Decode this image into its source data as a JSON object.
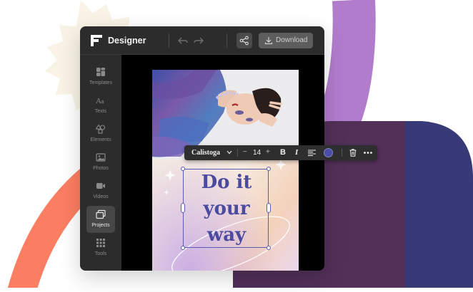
{
  "app": {
    "title": "Designer",
    "download_label": "Download",
    "icons": [
      "designer-logo-icon",
      "undo-icon",
      "redo-icon",
      "share-icon",
      "download-icon"
    ]
  },
  "sidebar": {
    "items": [
      {
        "label": "Templates",
        "icon": "templates-icon",
        "active": false
      },
      {
        "label": "Texts",
        "icon": "text-icon",
        "active": false
      },
      {
        "label": "Elements",
        "icon": "elements-icon",
        "active": false
      },
      {
        "label": "Photos",
        "icon": "photo-icon",
        "active": false
      },
      {
        "label": "Videos",
        "icon": "video-icon",
        "active": false
      },
      {
        "label": "Projects",
        "icon": "projects-icon",
        "active": true
      },
      {
        "label": "Tools",
        "icon": "tools-grid-icon",
        "active": false
      }
    ]
  },
  "text_toolbar": {
    "font": "Calistoga",
    "minus": "−",
    "size": "14",
    "plus": "+",
    "bold": "B",
    "italic": "I",
    "text_color": "#4b4ca8"
  },
  "canvas": {
    "headline_lines": [
      "Do it",
      "your",
      "way"
    ]
  },
  "colors": {
    "accent_purple": "#b27ccd",
    "navy": "#383a78",
    "plum": "#523058",
    "coral": "#fc7e62",
    "cream": "#f8f3e4",
    "headline": "#4a4aa0"
  }
}
